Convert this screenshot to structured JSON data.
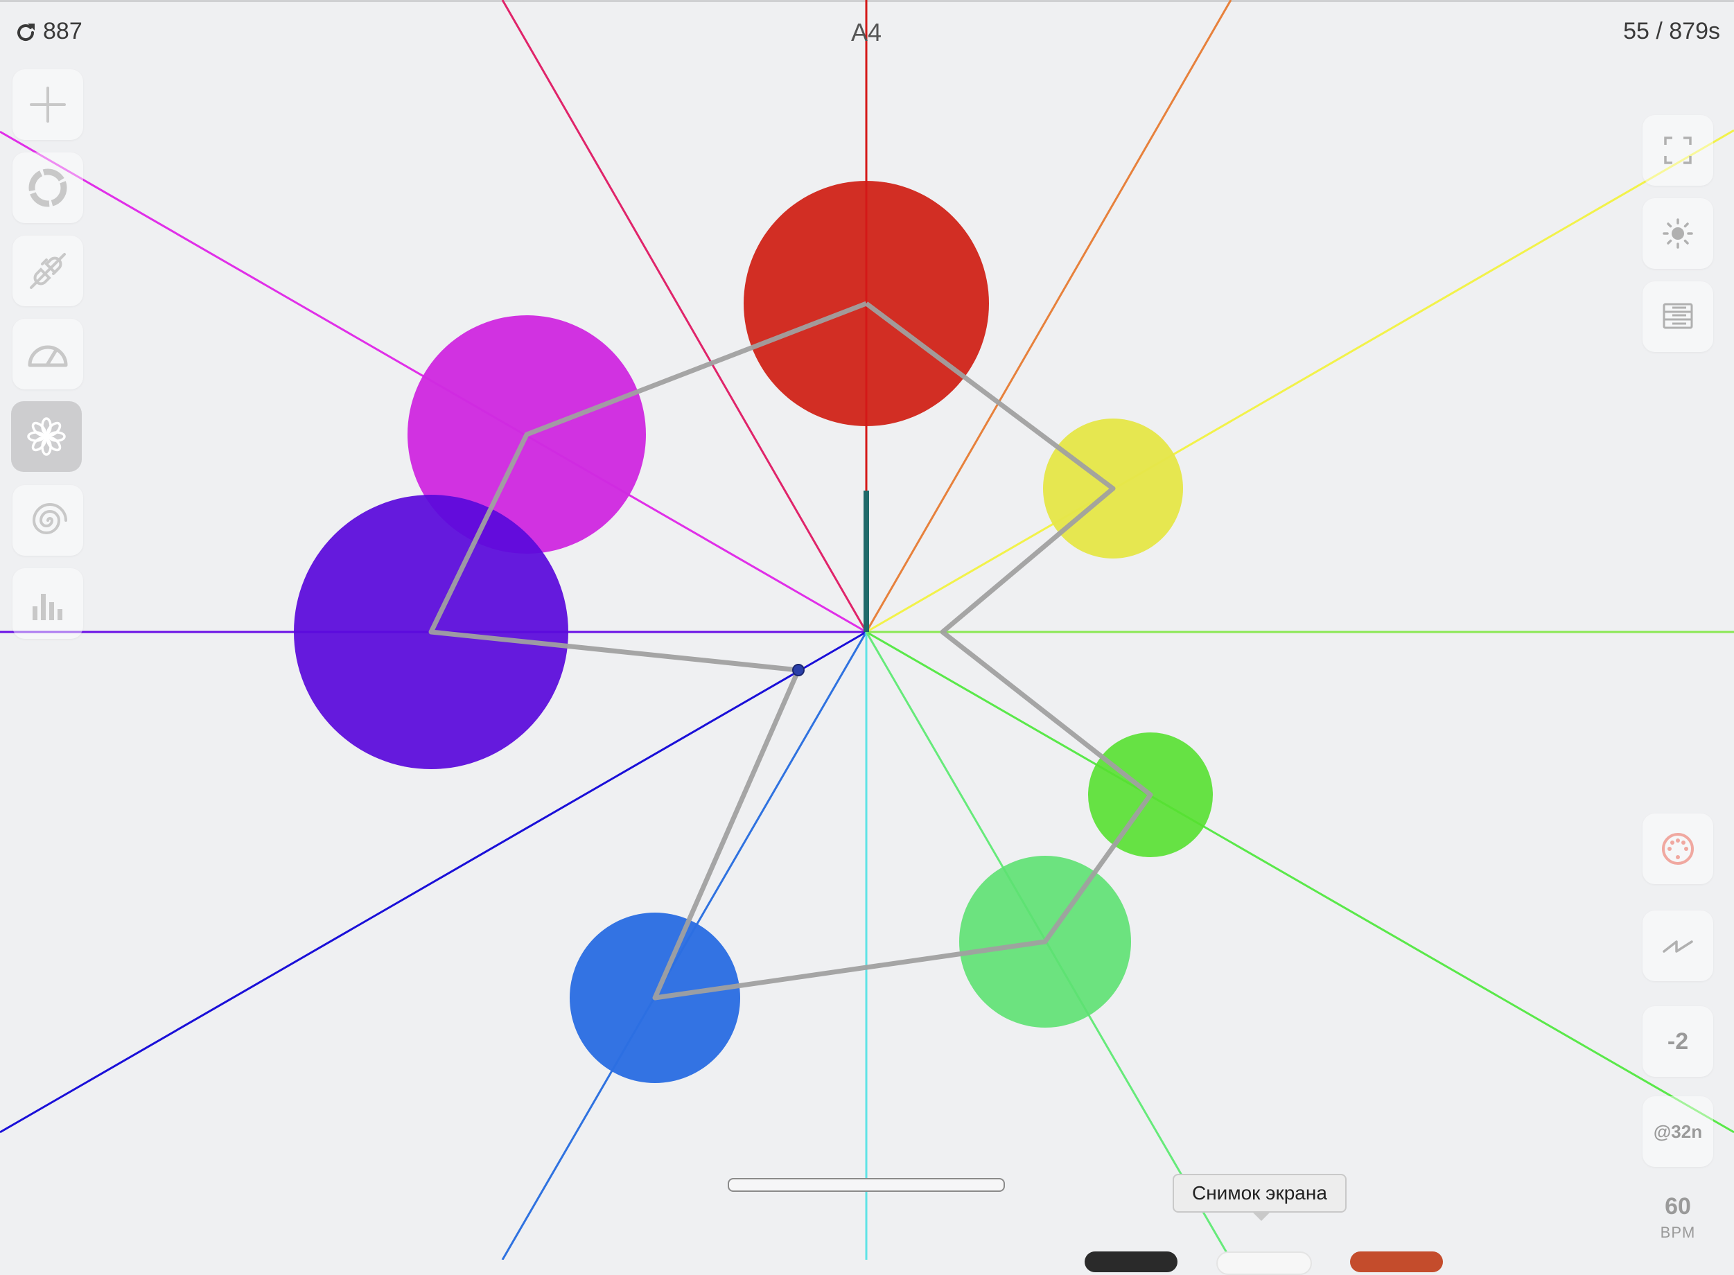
{
  "topbar": {
    "reload_icon": "reload-icon",
    "reload_count": "887",
    "note": "A4",
    "time": "55 / 879s"
  },
  "left_toolbar": [
    {
      "name": "add-button",
      "icon": "plus-icon",
      "active": false
    },
    {
      "name": "loop-button",
      "icon": "segmented-circle-icon",
      "active": false
    },
    {
      "name": "disconnect-button",
      "icon": "unplug-icon",
      "active": false
    },
    {
      "name": "speed-button",
      "icon": "gauge-icon",
      "active": false
    },
    {
      "name": "flower-button",
      "icon": "flower-icon",
      "active": true
    },
    {
      "name": "spiral-button",
      "icon": "spiral-icon",
      "active": false
    },
    {
      "name": "bars-button",
      "icon": "bar-chart-icon",
      "active": false
    }
  ],
  "right_toolbar": [
    {
      "name": "fullscreen-button",
      "icon": "fullscreen-icon"
    },
    {
      "name": "brightness-button",
      "icon": "sun-icon"
    },
    {
      "name": "list-button",
      "icon": "list-icon"
    },
    {
      "name": "midi-button",
      "icon": "midi-icon"
    },
    {
      "name": "wave-button",
      "icon": "zigzag-icon"
    }
  ],
  "right_values": {
    "transpose": "-2",
    "subdivision": "@32n",
    "bpm": "60",
    "bpm_unit": "BPM"
  },
  "tooltip": "Снимок экрана",
  "colors": {
    "background": "#eff0f2",
    "red": "#d12a20",
    "yellow": "#e5e64a",
    "green": "#66e14a",
    "light_green": "#67e37f",
    "blue": "#3374e3",
    "violet": "#6812de",
    "magenta": "#d12ee0",
    "path": "#a0a0a0"
  }
}
